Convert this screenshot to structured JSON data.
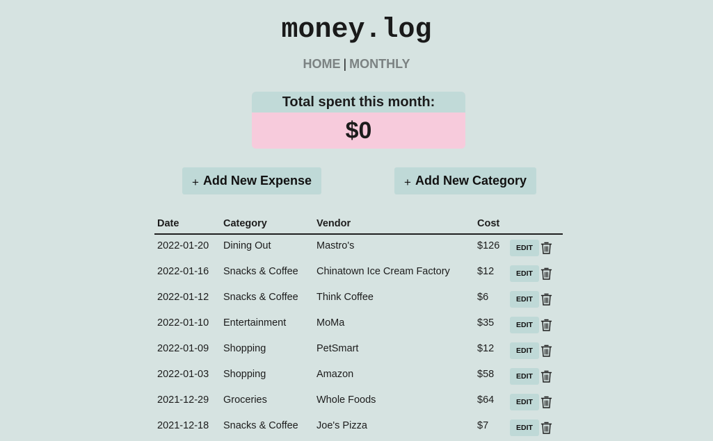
{
  "brand": "money.log",
  "nav": {
    "home": "HOME",
    "separator": "|",
    "monthly": "MONTHLY"
  },
  "total": {
    "label": "Total spent this month:",
    "amount": "$0"
  },
  "actions": {
    "plus_icon": "+",
    "add_expense": "Add New Expense",
    "add_category": "Add New Category"
  },
  "table": {
    "headers": {
      "date": "Date",
      "category": "Category",
      "vendor": "Vendor",
      "cost": "Cost"
    },
    "edit_label": "EDIT",
    "delete_icon": "trash-icon",
    "rows": [
      {
        "date": "2022-01-20",
        "category": "Dining Out",
        "vendor": "Mastro's",
        "cost": "$126"
      },
      {
        "date": "2022-01-16",
        "category": "Snacks & Coffee",
        "vendor": "Chinatown Ice Cream Factory",
        "cost": "$12"
      },
      {
        "date": "2022-01-12",
        "category": "Snacks & Coffee",
        "vendor": "Think Coffee",
        "cost": "$6"
      },
      {
        "date": "2022-01-10",
        "category": "Entertainment",
        "vendor": "MoMa",
        "cost": "$35"
      },
      {
        "date": "2022-01-09",
        "category": "Shopping",
        "vendor": "PetSmart",
        "cost": "$12"
      },
      {
        "date": "2022-01-03",
        "category": "Shopping",
        "vendor": "Amazon",
        "cost": "$58"
      },
      {
        "date": "2021-12-29",
        "category": "Groceries",
        "vendor": "Whole Foods",
        "cost": "$64"
      },
      {
        "date": "2021-12-18",
        "category": "Snacks & Coffee",
        "vendor": "Joe's Pizza",
        "cost": "$7"
      }
    ]
  },
  "colors": {
    "background": "#d6e3e1",
    "accent": "#bfd9d7",
    "total_highlight": "#f7cbdc",
    "nav_link": "#7b8282"
  }
}
